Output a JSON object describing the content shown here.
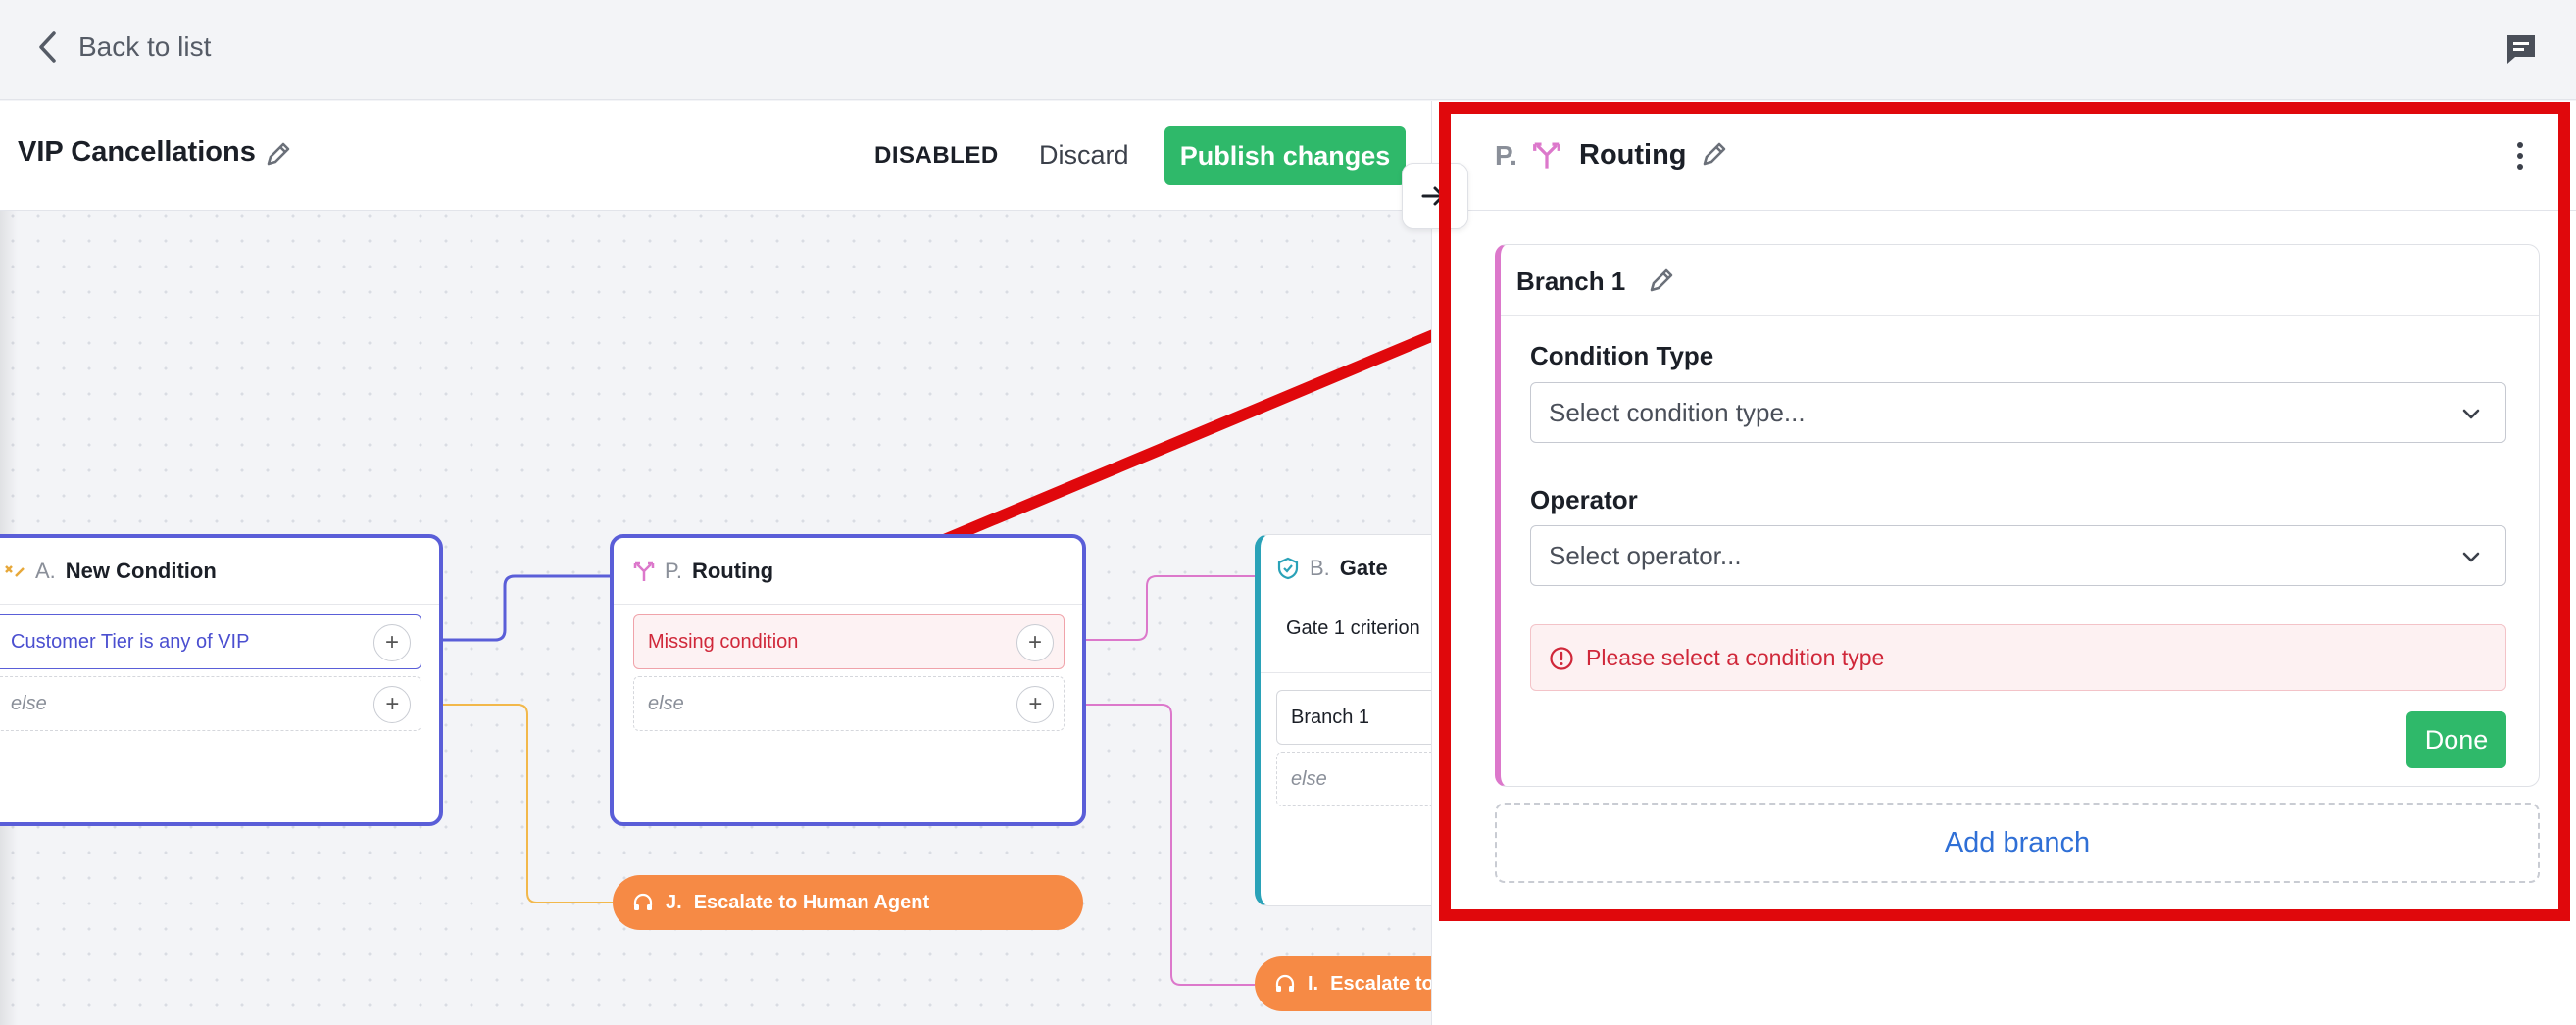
{
  "topbar": {
    "back_label": "Back to list"
  },
  "workflow": {
    "title": "VIP Cancellations",
    "status": "DISABLED",
    "discard_label": "Discard",
    "publish_label": "Publish changes"
  },
  "nodes": {
    "condition": {
      "letter": "A.",
      "name": "New Condition",
      "branch1": "Customer Tier is any of VIP",
      "else": "else"
    },
    "routing": {
      "letter": "P.",
      "name": "Routing",
      "branch1": "Missing condition",
      "else": "else"
    },
    "gate": {
      "letter": "B.",
      "name": "Gate",
      "criterion": "Gate 1 criterion",
      "branch1": "Branch 1",
      "else": "else"
    },
    "escalate_j": {
      "letter": "J.",
      "name": "Escalate to Human Agent"
    },
    "escalate_i": {
      "letter": "I.",
      "name": "Escalate to"
    }
  },
  "panel": {
    "letter": "P.",
    "title": "Routing",
    "branch": {
      "title": "Branch 1",
      "condition_type_label": "Condition Type",
      "condition_type_placeholder": "Select condition type...",
      "operator_label": "Operator",
      "operator_placeholder": "Select operator...",
      "error": "Please select a condition type",
      "done_label": "Done"
    },
    "add_branch_label": "Add branch"
  },
  "colors": {
    "accent_green": "#2fb96a",
    "routing_pink": "#dc78cb",
    "condition_blue": "#5a5ed8",
    "gate_teal": "#2aa2b8",
    "escalate_orange": "#f68a45",
    "error_red": "#d0283a",
    "highlight_red": "#e0080c"
  }
}
